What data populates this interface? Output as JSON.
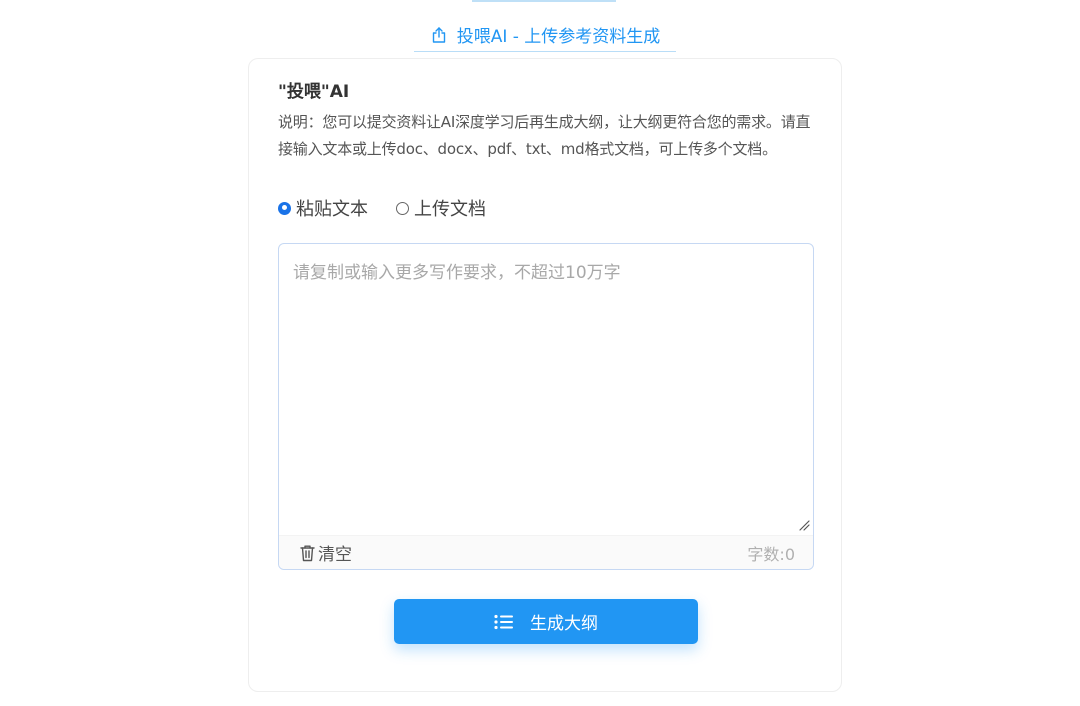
{
  "tab": {
    "label": "投喂AI - 上传参考资料生成",
    "icon": "upload-icon"
  },
  "card": {
    "title": "\"投喂\"AI",
    "description": "说明：您可以提交资料让AI深度学习后再生成大纲，让大纲更符合您的需求。请直接输入文本或上传doc、docx、pdf、txt、md格式文档，可上传多个文档。"
  },
  "input_mode": {
    "options": [
      {
        "label": "粘贴文本",
        "selected": true
      },
      {
        "label": "上传文档",
        "selected": false
      }
    ]
  },
  "textarea": {
    "value": "",
    "placeholder": "请复制或输入更多写作要求，不超过10万字"
  },
  "footer": {
    "clear_label": "清空",
    "char_count": "字数:0"
  },
  "generate_button": {
    "label": "生成大纲",
    "icon": "list-icon"
  },
  "colors": {
    "accent": "#2196f3",
    "radio_checked": "#1a73e8"
  }
}
